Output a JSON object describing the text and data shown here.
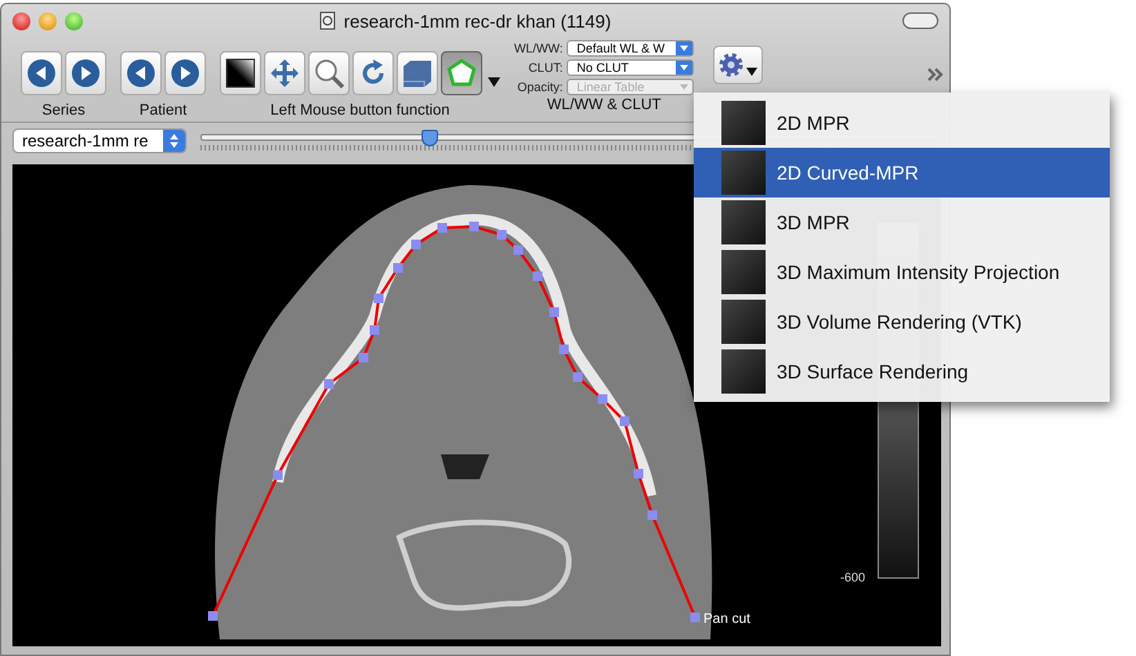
{
  "window": {
    "title": "research-1mm rec-dr khan (1149)"
  },
  "toolbar": {
    "series_label": "Series",
    "patient_label": "Patient",
    "mouse_label": "Left Mouse button function",
    "mouse_tools": [
      {
        "kind": "contrast",
        "selected": false
      },
      {
        "kind": "move",
        "selected": false
      },
      {
        "kind": "zoom",
        "selected": false
      },
      {
        "kind": "rotate",
        "selected": false
      },
      {
        "kind": "stack",
        "selected": false
      },
      {
        "kind": "polygon",
        "selected": true
      }
    ],
    "wl_fields": [
      {
        "label": "WL/WW:",
        "value": "Default WL & W",
        "disabled": false
      },
      {
        "label": "CLUT:",
        "value": "No CLUT",
        "disabled": false
      },
      {
        "label": "Opacity:",
        "value": "Linear Table",
        "disabled": true
      }
    ],
    "wl_label": "WL/WW & CLUT"
  },
  "series_select": {
    "value": "research-1mm re"
  },
  "slice_slider": {
    "level": 0.31
  },
  "viewer": {
    "roi_label": "Pan cut",
    "colorbar_label": "-600"
  },
  "menu": {
    "items": [
      {
        "label": "2D MPR",
        "selected": false
      },
      {
        "label": "2D Curved-MPR",
        "selected": true
      },
      {
        "label": "3D MPR",
        "selected": false
      },
      {
        "label": "3D Maximum Intensity Projection",
        "selected": false
      },
      {
        "label": "3D Volume Rendering (VTK)",
        "selected": false
      },
      {
        "label": "3D Surface Rendering",
        "selected": false
      }
    ]
  }
}
